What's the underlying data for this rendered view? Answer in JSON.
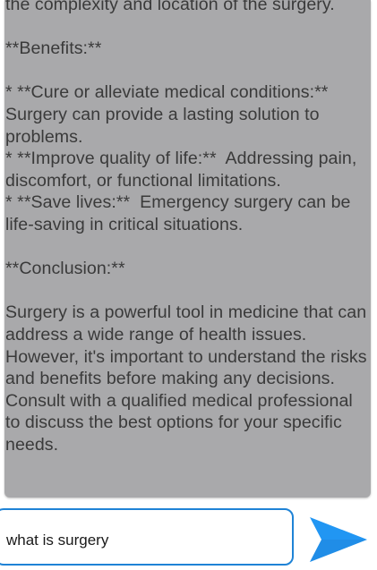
{
  "chat": {
    "bot_message": "the complexity and location of the surgery.\n\n**Benefits:**\n\n* **Cure or alleviate medical conditions:** Surgery can provide a lasting solution to problems.\n* **Improve quality of life:**  Addressing pain, discomfort, or functional limitations.\n* **Save lives:**  Emergency surgery can be life-saving in critical situations.\n\n**Conclusion:**\n\nSurgery is a powerful tool in medicine that can address a wide range of health issues.  However, it's important to understand the risks and benefits before making any decisions.  Consult with a qualified medical professional to discuss the best options for your specific needs."
  },
  "composer": {
    "input_value": "what is surgery",
    "send_icon": "send-arrow-icon"
  },
  "colors": {
    "user_bubble": "#2196f3",
    "bot_bubble": "#a9a9ab",
    "input_border": "#1f83d6",
    "send_icon": "#2196f3"
  }
}
